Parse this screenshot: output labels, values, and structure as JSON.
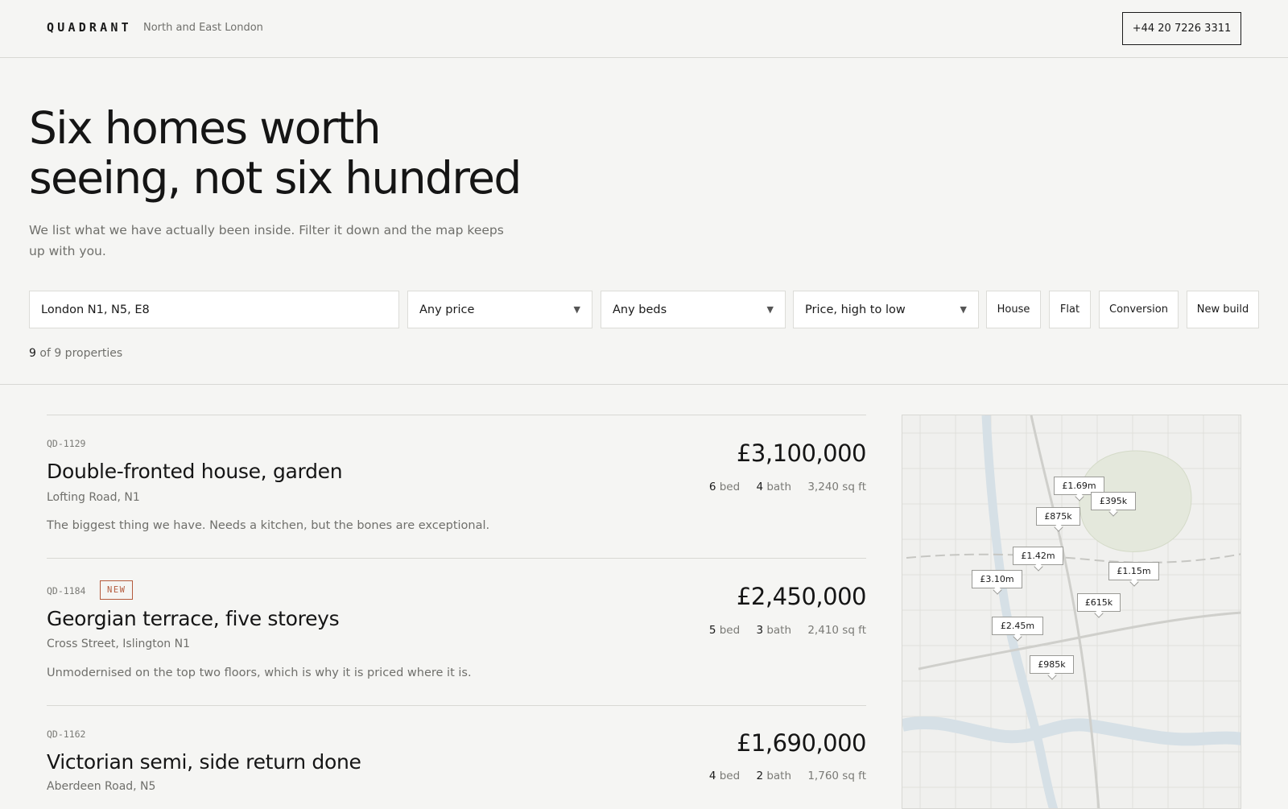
{
  "header": {
    "brand": "QUADRANT",
    "region": "North and East London",
    "phone": "+44 20 7226 3311"
  },
  "hero": {
    "title_line1": "Six homes worth",
    "title_line2": "seeing, not six hundred",
    "subtitle": "We list what we have actually been inside. Filter it down and the map keeps up with you."
  },
  "filters": {
    "location_value": "London N1, N5, E8",
    "price": "Any price",
    "beds": "Any beds",
    "sort": "Price, high to low",
    "chips": [
      "House",
      "Flat",
      "Conversion",
      "New build"
    ]
  },
  "results": {
    "shown": "9",
    "total_text": "of 9 properties"
  },
  "listings": [
    {
      "ref": "QD-1129",
      "badge": "",
      "title": "Double-fronted house, garden",
      "address": "Lofting Road, N1",
      "description": "The biggest thing we have. Needs a kitchen, but the bones are exceptional.",
      "price": "£3,100,000",
      "beds": "6",
      "baths": "4",
      "area": "3,240 sq ft"
    },
    {
      "ref": "QD-1184",
      "badge": "NEW",
      "title": "Georgian terrace, five storeys",
      "address": "Cross Street, Islington N1",
      "description": "Unmodernised on the top two floors, which is why it is priced where it is.",
      "price": "£2,450,000",
      "beds": "5",
      "baths": "3",
      "area": "2,410 sq ft"
    },
    {
      "ref": "QD-1162",
      "badge": "",
      "title": "Victorian semi, side return done",
      "address": "Aberdeen Road, N5",
      "description": "",
      "price": "£1,690,000",
      "beds": "4",
      "baths": "2",
      "area": "1,760 sq ft"
    }
  ],
  "labels": {
    "bed": "bed",
    "bath": "bath"
  },
  "map": {
    "pins": [
      "£1.69m",
      "£395k",
      "£875k",
      "£1.42m",
      "£1.15m",
      "£3.10m",
      "£615k",
      "£2.45m",
      "£985k"
    ],
    "colors": {
      "water": "#d6e0e6",
      "park": "#e4e8dc",
      "road": "#cfcfcb"
    }
  }
}
